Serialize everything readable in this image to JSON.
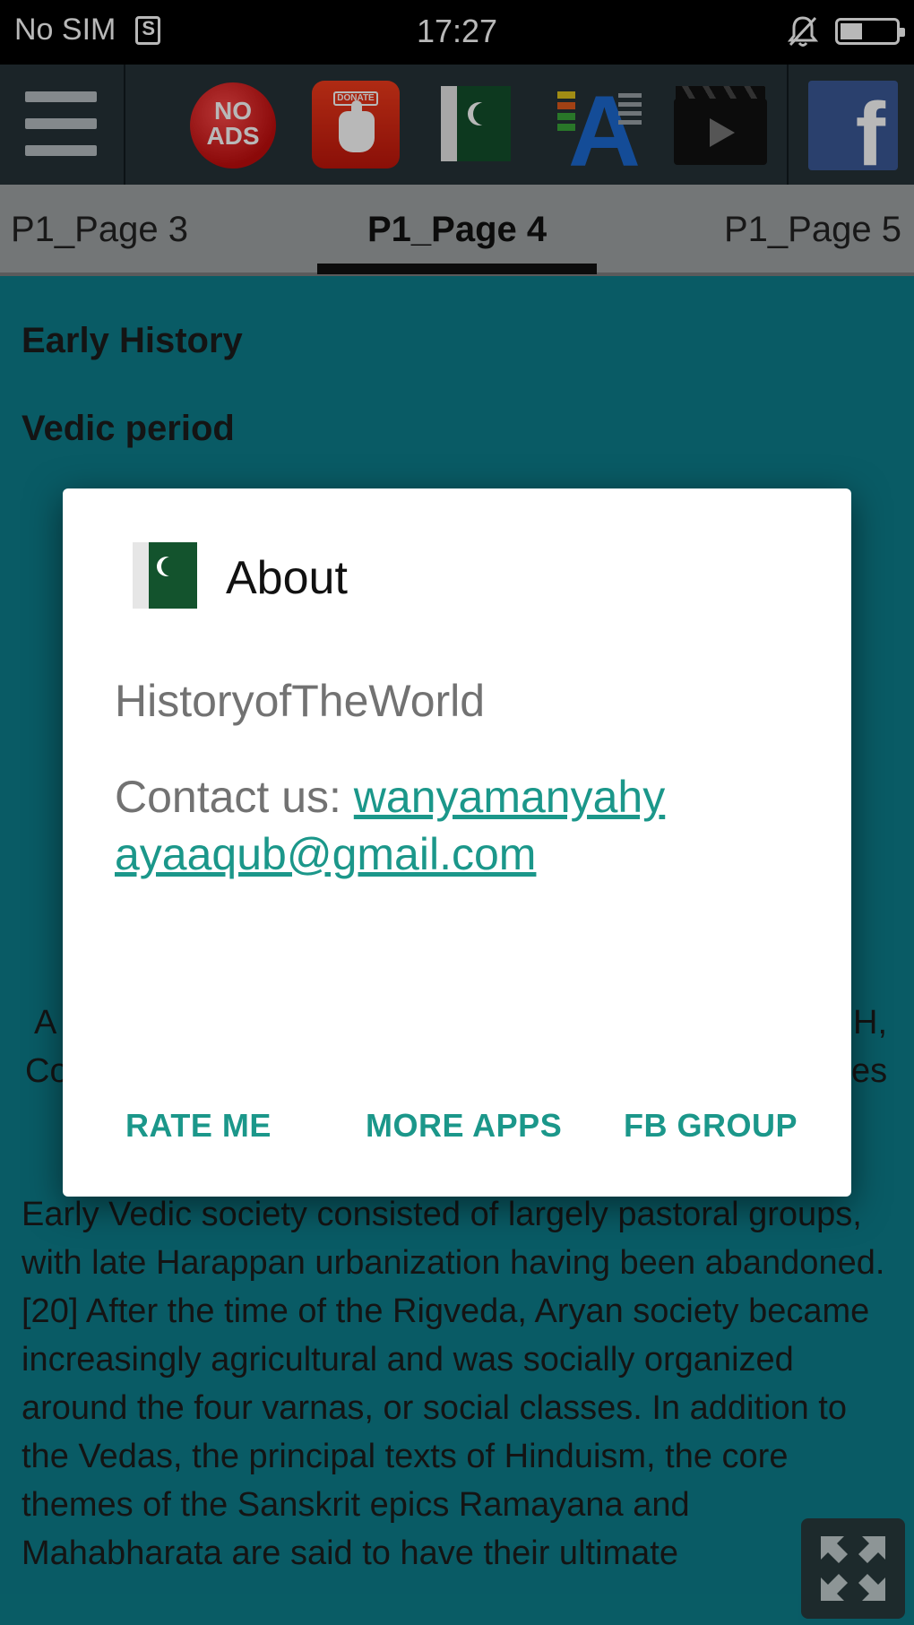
{
  "status_bar": {
    "carrier": "No SIM",
    "time": "17:27",
    "icons": [
      "sim-icon",
      "mute-icon",
      "battery-icon"
    ]
  },
  "toolbar": {
    "no_ads_label": "NO\nADS",
    "donate_tag": "DONATE",
    "icons": [
      "menu-icon",
      "no-ads-icon",
      "donate-icon",
      "pakistan-flag-icon",
      "font-size-icon",
      "video-icon",
      "facebook-icon"
    ]
  },
  "tabs": {
    "prev": "P1_Page 3",
    "current": "P1_Page 4",
    "next": "P1_Page 5"
  },
  "content": {
    "heading1": "Early History",
    "heading2": "Vedic period",
    "fragment_left_1": "A",
    "fragment_left_2": "Co",
    "fragment_right_1": "H,",
    "fragment_right_2": "es",
    "paragraph": "Early Vedic society consisted of largely pastoral groups, with late Harappan urbanization having been abandoned.[20] After the time of the Rigveda, Aryan society became increasingly agricultural and was socially organized around the four varnas, or social classes. In addition to the Vedas, the principal texts of Hinduism, the core themes of the Sanskrit epics Ramayana and Mahabharata are said to have their ultimate"
  },
  "dialog": {
    "title": "About",
    "app_name": "HistoryofTheWorld",
    "contact_label": "Contact us: ",
    "contact_email": "wanyamanyahyayaaqub@gmail.com",
    "buttons": {
      "rate": "RATE ME",
      "more_apps": "MORE APPS",
      "fb_group": "FB GROUP"
    }
  },
  "colors": {
    "content_bg": "#0d7f8c",
    "toolbar_bg": "#263238",
    "accent": "#1b978a"
  }
}
